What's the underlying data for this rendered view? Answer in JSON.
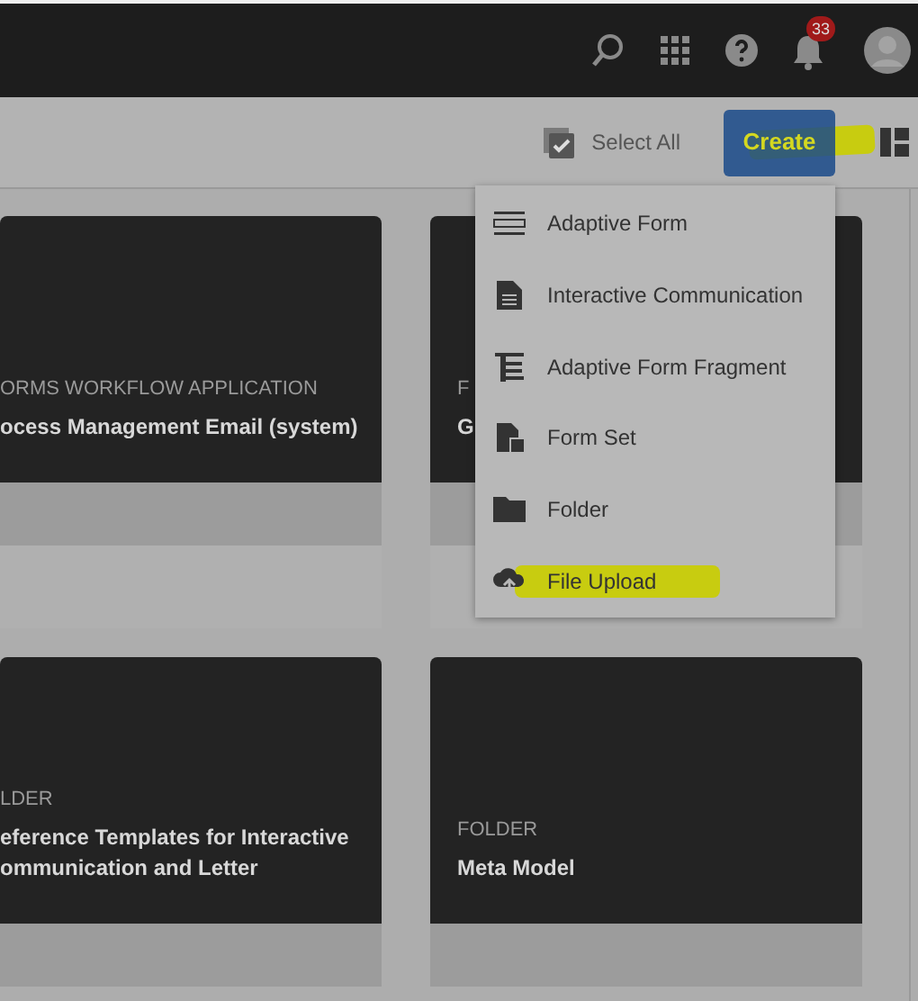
{
  "header": {
    "notification_count": "33"
  },
  "toolbar": {
    "select_all": "Select All",
    "create": {
      "label": "Create",
      "highlighted": true
    }
  },
  "cards": [
    {
      "type_label": "ORMS WORKFLOW APPLICATION",
      "title_lines": [
        "ocess Management Email (system)"
      ]
    },
    {
      "type_label": "F",
      "title_lines": [
        "G"
      ]
    },
    {
      "type_label": "LDER",
      "title_lines": [
        "eference Templates for Interactive",
        "ommunication and Letter"
      ]
    },
    {
      "type_label": "FOLDER",
      "title_lines": [
        "Meta Model"
      ]
    }
  ],
  "create_menu": [
    {
      "kind": "adaptive-form",
      "label": "Adaptive Form",
      "highlighted": false
    },
    {
      "kind": "document",
      "label": "Interactive Communication",
      "highlighted": false
    },
    {
      "kind": "fragment",
      "label": "Adaptive Form Fragment",
      "highlighted": false
    },
    {
      "kind": "form-set",
      "label": "Form Set",
      "highlighted": false
    },
    {
      "kind": "folder",
      "label": "Folder",
      "highlighted": false
    },
    {
      "kind": "upload",
      "label": "File Upload",
      "highlighted": true
    }
  ]
}
